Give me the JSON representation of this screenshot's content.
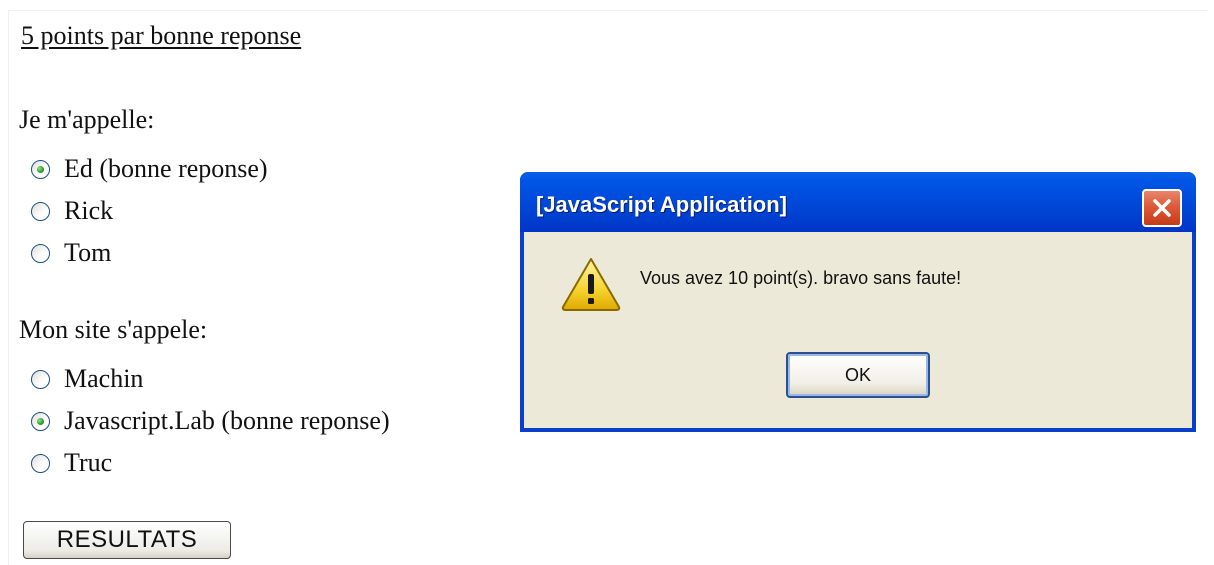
{
  "page": {
    "heading": "5 points par bonne reponse",
    "questions": [
      {
        "label": "Je m'appelle:",
        "options": [
          {
            "label": "Ed (bonne reponse)",
            "checked": true
          },
          {
            "label": "Rick",
            "checked": false
          },
          {
            "label": "Tom",
            "checked": false
          }
        ]
      },
      {
        "label": "Mon site s'appele:",
        "options": [
          {
            "label": "Machin",
            "checked": false
          },
          {
            "label": "Javascript.Lab (bonne reponse)",
            "checked": true
          },
          {
            "label": "Truc",
            "checked": false
          }
        ]
      }
    ],
    "submit_label": "RESULTATS"
  },
  "dialog": {
    "title": "[JavaScript Application]",
    "message": "Vous avez 10 point(s). bravo sans faute!",
    "icon": "warning-icon",
    "ok_label": "OK",
    "close_icon": "close-icon"
  },
  "colors": {
    "titlebar": "#0054e3",
    "dialog_body": "#ece9d8",
    "close_button": "#d8552e",
    "radio_selected": "#21a121"
  }
}
